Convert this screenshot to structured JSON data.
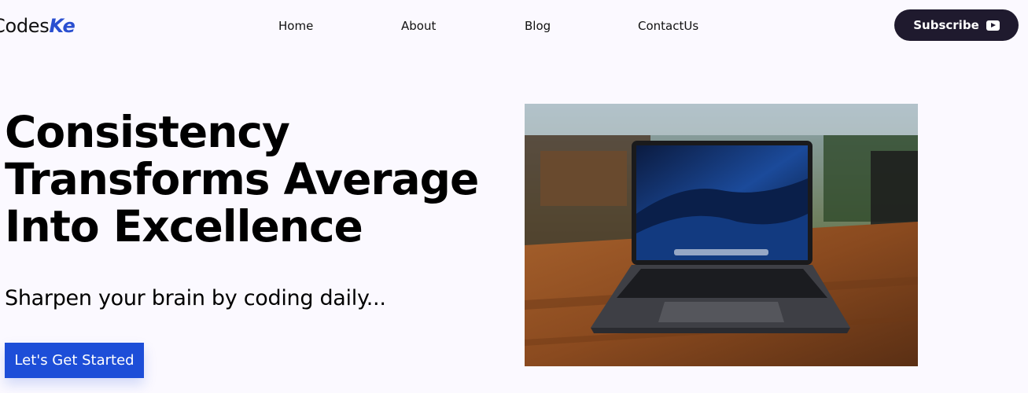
{
  "nav": {
    "logo_main": "Codes",
    "logo_accent": "Ke",
    "links": [
      "Home",
      "About",
      "Blog",
      "ContactUs"
    ],
    "subscribe_label": "Subscribe",
    "subscribe_icon": "youtube-icon"
  },
  "hero": {
    "title_lines": [
      "Consistency",
      "Transforms Average",
      "Into Excellence"
    ],
    "subtitle": "Sharpen your brain by coding daily...",
    "cta_label": "Let's Get Started",
    "image_subject": "laptop-on-wooden-table-photo"
  },
  "colors": {
    "background": "#fbf9ff",
    "accent": "#2a4fd0",
    "cta": "#1d4ed8",
    "subscribe_bg": "#1f1a2e"
  }
}
